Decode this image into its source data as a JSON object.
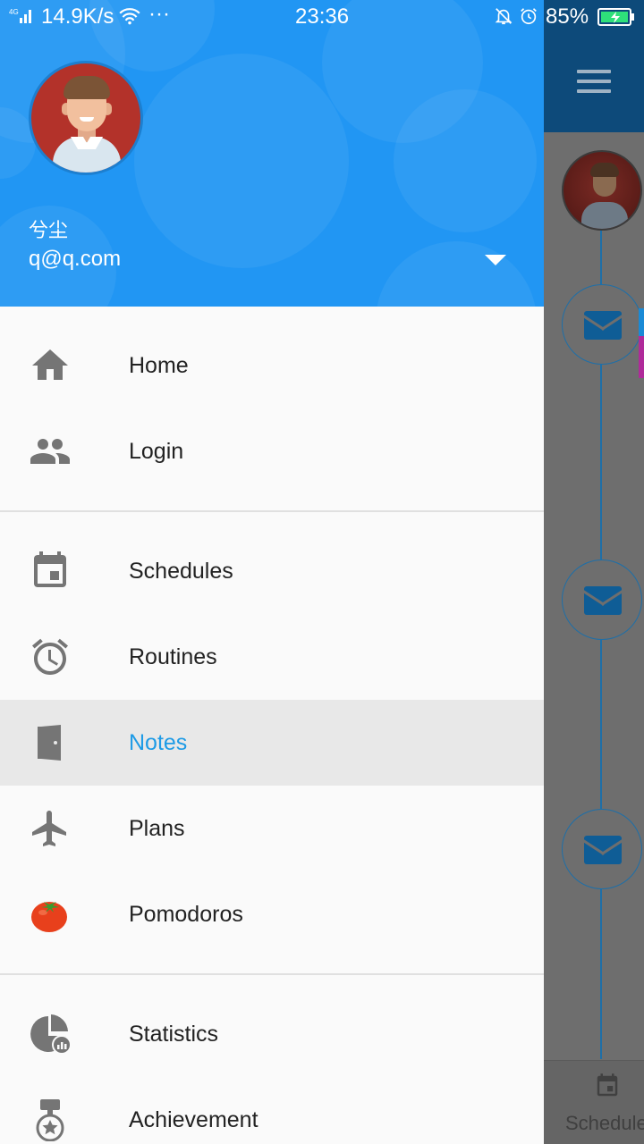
{
  "status_bar": {
    "network": "4G",
    "speed": "14.9K/s",
    "more": "···",
    "time": "23:36",
    "battery": "85%"
  },
  "drawer": {
    "user": {
      "name": "兮尘",
      "email": "q@q.com"
    },
    "groups": [
      [
        {
          "label": "Home",
          "icon": "home-icon"
        },
        {
          "label": "Login",
          "icon": "people-icon"
        }
      ],
      [
        {
          "label": "Schedules",
          "icon": "calendar-icon"
        },
        {
          "label": "Routines",
          "icon": "alarm-clock-icon"
        },
        {
          "label": "Notes",
          "icon": "door-icon",
          "selected": true
        },
        {
          "label": "Plans",
          "icon": "airplane-icon"
        },
        {
          "label": "Pomodoros",
          "icon": "tomato-icon"
        }
      ],
      [
        {
          "label": "Statistics",
          "icon": "pie-chart-icon"
        },
        {
          "label": "Achievement",
          "icon": "medal-icon"
        }
      ]
    ]
  },
  "background": {
    "bottom_tab_label": "Schedules"
  },
  "colors": {
    "header": "#2196f3",
    "selected_text": "#1e9be6",
    "selected_bg": "#e8e8e8",
    "icon_gray": "#757575"
  }
}
